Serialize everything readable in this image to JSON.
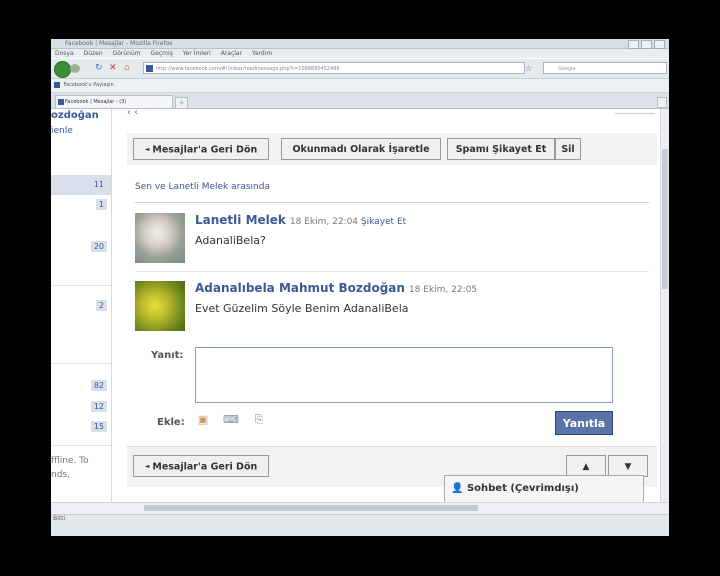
{
  "browser": {
    "title": "Facebook | Mesajlar - Mozilla Firefox",
    "menu": [
      "Dosya",
      "Düzen",
      "Görünüm",
      "Geçmiş",
      "Yer İmleri",
      "Araçlar",
      "Yardım"
    ],
    "url": "http://www.facebook.com/#!/inbox/readmessage.php?t=1098880452496",
    "search_placeholder": "Google",
    "bookmark": "Facebook'u Paylaşın",
    "tab_label": "Facebook | Mesajlar - (3)",
    "status": "Bitti",
    "new_tab": "+"
  },
  "sidebar": {
    "name": "ozdoğan",
    "sub": "ienle",
    "counts": [
      "11",
      "1",
      "20",
      "2",
      "82",
      "12",
      "15"
    ],
    "offline_text": "ffline. To\nnds,"
  },
  "toolbar": {
    "back": "Mesajlar'a Geri Dön",
    "mark_unread": "Okunmadı Olarak İşaretle",
    "report_spam": "Spamı Şikayet Et",
    "delete": "Sil"
  },
  "thread": {
    "between": "Sen ve Lanetli Melek arasında",
    "messages": [
      {
        "author": "Lanetli Melek",
        "time": "18 Ekim, 22:04",
        "report": "Şikayet Et",
        "text": "AdanaliBela?"
      },
      {
        "author": "Adanalıbela Mahmut Bozdoğan",
        "time": "18 Ekim, 22:05",
        "report": "",
        "text": "Evet Güzelim Söyle Benim AdanaliBela"
      }
    ]
  },
  "reply": {
    "label": "Yanıt:",
    "attach_label": "Ekle:",
    "submit": "Yanıtla"
  },
  "bottom": {
    "back": "Mesajlar'a Geri Dön",
    "up": "▲",
    "down": "▼"
  },
  "chat": {
    "label": "Sohbet (Çevrimdışı)"
  }
}
